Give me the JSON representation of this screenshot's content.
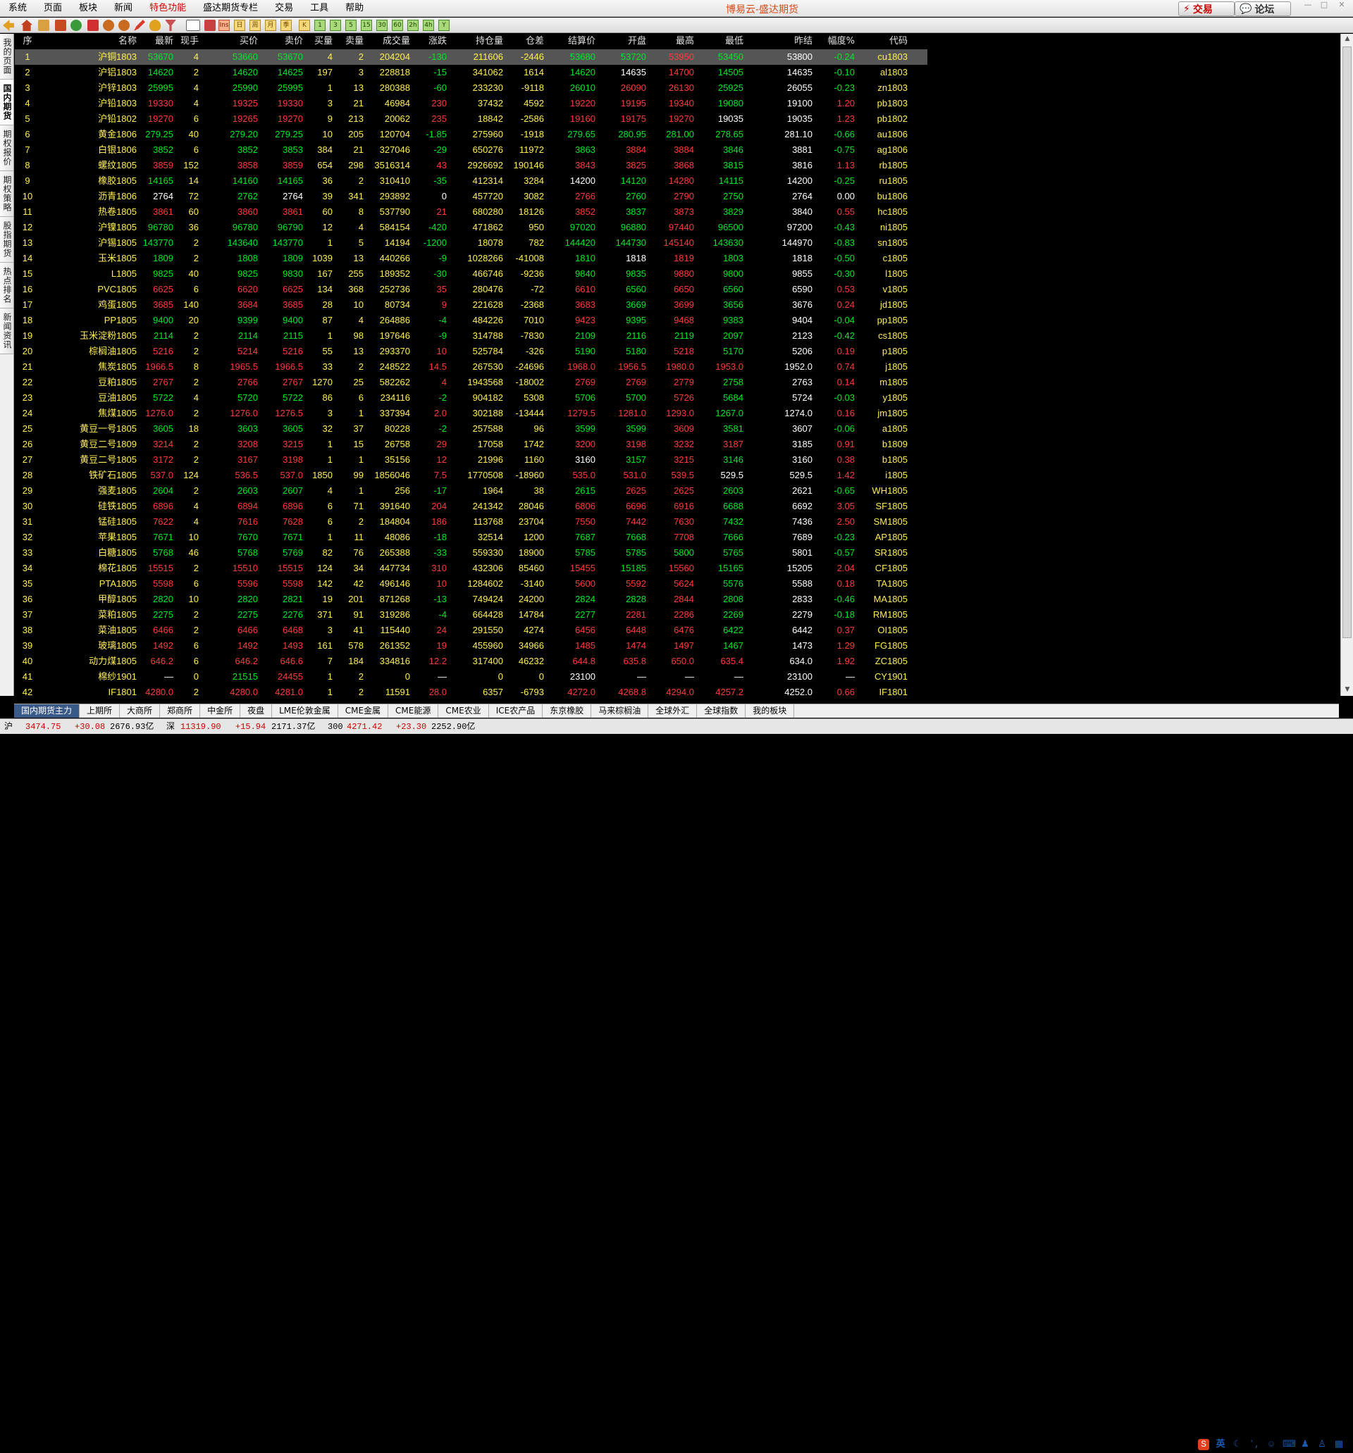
{
  "menu": [
    "系统",
    "页面",
    "板块",
    "新闻",
    "特色功能",
    "盛达期货专栏",
    "交易",
    "工具",
    "帮助"
  ],
  "app_title": "博易云-盛达期货",
  "buttons": {
    "trade": "交易",
    "forum": "论坛"
  },
  "toolbar_keys": [
    "Ins",
    "日",
    "周",
    "月",
    "季",
    "K",
    "1",
    "3",
    "5",
    "15",
    "30",
    "60",
    "2h",
    "4h",
    "Y"
  ],
  "left_nav": [
    "我的页面",
    "国内期货",
    "期权报价",
    "期权策略",
    "股指期货",
    "热点排名",
    "新闻资讯"
  ],
  "columns": [
    "序",
    "名称",
    "最新",
    "现手",
    "买价",
    "卖价",
    "买量",
    "卖量",
    "成交量",
    "涨跌",
    "持仓量",
    "仓差",
    "结算价",
    "开盘",
    "最高",
    "最低",
    "昨结",
    "幅度%",
    "代码"
  ],
  "rows": [
    [
      "1",
      "沪铜1803",
      "53670",
      "4",
      "53660",
      "53670",
      "4",
      "2",
      "204204",
      "-130",
      "211606",
      "-2446",
      "53680",
      "53720",
      "53950",
      "53450",
      "53800",
      "-0.24",
      "cu1803"
    ],
    [
      "2",
      "沪铝1803",
      "14620",
      "2",
      "14620",
      "14625",
      "197",
      "3",
      "228818",
      "-15",
      "341062",
      "1614",
      "14620",
      "14635",
      "14700",
      "14505",
      "14635",
      "-0.10",
      "al1803"
    ],
    [
      "3",
      "沪锌1803",
      "25995",
      "4",
      "25990",
      "25995",
      "1",
      "13",
      "280388",
      "-60",
      "233230",
      "-9118",
      "26010",
      "26090",
      "26130",
      "25925",
      "26055",
      "-0.23",
      "zn1803"
    ],
    [
      "4",
      "沪铅1803",
      "19330",
      "4",
      "19325",
      "19330",
      "3",
      "21",
      "46984",
      "230",
      "37432",
      "4592",
      "19220",
      "19195",
      "19340",
      "19080",
      "19100",
      "1.20",
      "pb1803"
    ],
    [
      "5",
      "沪铅1802",
      "19270",
      "6",
      "19265",
      "19270",
      "9",
      "213",
      "20062",
      "235",
      "18842",
      "-2586",
      "19160",
      "19175",
      "19270",
      "19035",
      "19035",
      "1.23",
      "pb1802"
    ],
    [
      "6",
      "黄金1806",
      "279.25",
      "40",
      "279.20",
      "279.25",
      "10",
      "205",
      "120704",
      "-1.85",
      "275960",
      "-1918",
      "279.65",
      "280.95",
      "281.00",
      "278.65",
      "281.10",
      "-0.66",
      "au1806"
    ],
    [
      "7",
      "白银1806",
      "3852",
      "6",
      "3852",
      "3853",
      "384",
      "21",
      "327046",
      "-29",
      "650276",
      "11972",
      "3863",
      "3884",
      "3884",
      "3846",
      "3881",
      "-0.75",
      "ag1806"
    ],
    [
      "8",
      "螺纹1805",
      "3859",
      "152",
      "3858",
      "3859",
      "654",
      "298",
      "3516314",
      "43",
      "2926692",
      "190146",
      "3843",
      "3825",
      "3868",
      "3815",
      "3816",
      "1.13",
      "rb1805"
    ],
    [
      "9",
      "橡胶1805",
      "14165",
      "14",
      "14160",
      "14165",
      "36",
      "2",
      "310410",
      "-35",
      "412314",
      "3284",
      "14200",
      "14120",
      "14280",
      "14115",
      "14200",
      "-0.25",
      "ru1805"
    ],
    [
      "10",
      "沥青1806",
      "2764",
      "72",
      "2762",
      "2764",
      "39",
      "341",
      "293892",
      "0",
      "457720",
      "3082",
      "2766",
      "2760",
      "2790",
      "2750",
      "2764",
      "0.00",
      "bu1806"
    ],
    [
      "11",
      "热卷1805",
      "3861",
      "60",
      "3860",
      "3861",
      "60",
      "8",
      "537790",
      "21",
      "680280",
      "18126",
      "3852",
      "3837",
      "3873",
      "3829",
      "3840",
      "0.55",
      "hc1805"
    ],
    [
      "12",
      "沪镍1805",
      "96780",
      "36",
      "96780",
      "96790",
      "12",
      "4",
      "584154",
      "-420",
      "471862",
      "950",
      "97020",
      "96880",
      "97440",
      "96500",
      "97200",
      "-0.43",
      "ni1805"
    ],
    [
      "13",
      "沪锡1805",
      "143770",
      "2",
      "143640",
      "143770",
      "1",
      "5",
      "14194",
      "-1200",
      "18078",
      "782",
      "144420",
      "144730",
      "145140",
      "143630",
      "144970",
      "-0.83",
      "sn1805"
    ],
    [
      "14",
      "玉米1805",
      "1809",
      "2",
      "1808",
      "1809",
      "1039",
      "13",
      "440266",
      "-9",
      "1028266",
      "-41008",
      "1810",
      "1818",
      "1819",
      "1803",
      "1818",
      "-0.50",
      "c1805"
    ],
    [
      "15",
      "L1805",
      "9825",
      "40",
      "9825",
      "9830",
      "167",
      "255",
      "189352",
      "-30",
      "466746",
      "-9236",
      "9840",
      "9835",
      "9880",
      "9800",
      "9855",
      "-0.30",
      "l1805"
    ],
    [
      "16",
      "PVC1805",
      "6625",
      "6",
      "6620",
      "6625",
      "134",
      "368",
      "252736",
      "35",
      "280476",
      "-72",
      "6610",
      "6560",
      "6650",
      "6560",
      "6590",
      "0.53",
      "v1805"
    ],
    [
      "17",
      "鸡蛋1805",
      "3685",
      "140",
      "3684",
      "3685",
      "28",
      "10",
      "80734",
      "9",
      "221628",
      "-2368",
      "3683",
      "3669",
      "3699",
      "3656",
      "3676",
      "0.24",
      "jd1805"
    ],
    [
      "18",
      "PP1805",
      "9400",
      "20",
      "9399",
      "9400",
      "87",
      "4",
      "264886",
      "-4",
      "484226",
      "7010",
      "9423",
      "9395",
      "9468",
      "9383",
      "9404",
      "-0.04",
      "pp1805"
    ],
    [
      "19",
      "玉米淀粉1805",
      "2114",
      "2",
      "2114",
      "2115",
      "1",
      "98",
      "197646",
      "-9",
      "314788",
      "-7830",
      "2109",
      "2116",
      "2119",
      "2097",
      "2123",
      "-0.42",
      "cs1805"
    ],
    [
      "20",
      "棕榈油1805",
      "5216",
      "2",
      "5214",
      "5216",
      "55",
      "13",
      "293370",
      "10",
      "525784",
      "-326",
      "5190",
      "5180",
      "5218",
      "5170",
      "5206",
      "0.19",
      "p1805"
    ],
    [
      "21",
      "焦炭1805",
      "1966.5",
      "8",
      "1965.5",
      "1966.5",
      "33",
      "2",
      "248522",
      "14.5",
      "267530",
      "-24696",
      "1968.0",
      "1956.5",
      "1980.0",
      "1953.0",
      "1952.0",
      "0.74",
      "j1805"
    ],
    [
      "22",
      "豆粕1805",
      "2767",
      "2",
      "2766",
      "2767",
      "1270",
      "25",
      "582262",
      "4",
      "1943568",
      "-18002",
      "2769",
      "2769",
      "2779",
      "2758",
      "2763",
      "0.14",
      "m1805"
    ],
    [
      "23",
      "豆油1805",
      "5722",
      "4",
      "5720",
      "5722",
      "86",
      "6",
      "234116",
      "-2",
      "904182",
      "5308",
      "5706",
      "5700",
      "5726",
      "5684",
      "5724",
      "-0.03",
      "y1805"
    ],
    [
      "24",
      "焦煤1805",
      "1276.0",
      "2",
      "1276.0",
      "1276.5",
      "3",
      "1",
      "337394",
      "2.0",
      "302188",
      "-13444",
      "1279.5",
      "1281.0",
      "1293.0",
      "1267.0",
      "1274.0",
      "0.16",
      "jm1805"
    ],
    [
      "25",
      "黄豆一号1805",
      "3605",
      "18",
      "3603",
      "3605",
      "32",
      "37",
      "80228",
      "-2",
      "257588",
      "96",
      "3599",
      "3599",
      "3609",
      "3581",
      "3607",
      "-0.06",
      "a1805"
    ],
    [
      "26",
      "黄豆二号1809",
      "3214",
      "2",
      "3208",
      "3215",
      "1",
      "15",
      "26758",
      "29",
      "17058",
      "1742",
      "3200",
      "3198",
      "3232",
      "3187",
      "3185",
      "0.91",
      "b1809"
    ],
    [
      "27",
      "黄豆二号1805",
      "3172",
      "2",
      "3167",
      "3198",
      "1",
      "1",
      "35156",
      "12",
      "21996",
      "1160",
      "3160",
      "3157",
      "3215",
      "3146",
      "3160",
      "0.38",
      "b1805"
    ],
    [
      "28",
      "铁矿石1805",
      "537.0",
      "124",
      "536.5",
      "537.0",
      "1850",
      "99",
      "1856046",
      "7.5",
      "1770508",
      "-18960",
      "535.0",
      "531.0",
      "539.5",
      "529.5",
      "529.5",
      "1.42",
      "i1805"
    ],
    [
      "29",
      "强麦1805",
      "2604",
      "2",
      "2603",
      "2607",
      "4",
      "1",
      "256",
      "-17",
      "1964",
      "38",
      "2615",
      "2625",
      "2625",
      "2603",
      "2621",
      "-0.65",
      "WH1805"
    ],
    [
      "30",
      "硅铁1805",
      "6896",
      "4",
      "6894",
      "6896",
      "6",
      "71",
      "391640",
      "204",
      "241342",
      "28046",
      "6806",
      "6696",
      "6916",
      "6688",
      "6692",
      "3.05",
      "SF1805"
    ],
    [
      "31",
      "锰硅1805",
      "7622",
      "4",
      "7616",
      "7628",
      "6",
      "2",
      "184804",
      "186",
      "113768",
      "23704",
      "7550",
      "7442",
      "7630",
      "7432",
      "7436",
      "2.50",
      "SM1805"
    ],
    [
      "32",
      "苹果1805",
      "7671",
      "10",
      "7670",
      "7671",
      "1",
      "11",
      "48086",
      "-18",
      "32514",
      "1200",
      "7687",
      "7668",
      "7708",
      "7666",
      "7689",
      "-0.23",
      "AP1805"
    ],
    [
      "33",
      "白糖1805",
      "5768",
      "46",
      "5768",
      "5769",
      "82",
      "76",
      "265388",
      "-33",
      "559330",
      "18900",
      "5785",
      "5785",
      "5800",
      "5765",
      "5801",
      "-0.57",
      "SR1805"
    ],
    [
      "34",
      "棉花1805",
      "15515",
      "2",
      "15510",
      "15515",
      "124",
      "34",
      "447734",
      "310",
      "432306",
      "85460",
      "15455",
      "15185",
      "15560",
      "15165",
      "15205",
      "2.04",
      "CF1805"
    ],
    [
      "35",
      "PTA1805",
      "5598",
      "6",
      "5596",
      "5598",
      "142",
      "42",
      "496146",
      "10",
      "1284602",
      "-3140",
      "5600",
      "5592",
      "5624",
      "5576",
      "5588",
      "0.18",
      "TA1805"
    ],
    [
      "36",
      "甲醇1805",
      "2820",
      "10",
      "2820",
      "2821",
      "19",
      "201",
      "871268",
      "-13",
      "749424",
      "24200",
      "2824",
      "2828",
      "2844",
      "2808",
      "2833",
      "-0.46",
      "MA1805"
    ],
    [
      "37",
      "菜粕1805",
      "2275",
      "2",
      "2275",
      "2276",
      "371",
      "91",
      "319286",
      "-4",
      "664428",
      "14784",
      "2277",
      "2281",
      "2286",
      "2269",
      "2279",
      "-0.18",
      "RM1805"
    ],
    [
      "38",
      "菜油1805",
      "6466",
      "2",
      "6466",
      "6468",
      "3",
      "41",
      "115440",
      "24",
      "291550",
      "4274",
      "6456",
      "6448",
      "6476",
      "6422",
      "6442",
      "0.37",
      "OI1805"
    ],
    [
      "39",
      "玻璃1805",
      "1492",
      "6",
      "1492",
      "1493",
      "161",
      "578",
      "261352",
      "19",
      "455960",
      "34966",
      "1485",
      "1474",
      "1497",
      "1467",
      "1473",
      "1.29",
      "FG1805"
    ],
    [
      "40",
      "动力煤1805",
      "646.2",
      "6",
      "646.2",
      "646.6",
      "7",
      "184",
      "334816",
      "12.2",
      "317400",
      "46232",
      "644.8",
      "635.8",
      "650.0",
      "635.4",
      "634.0",
      "1.92",
      "ZC1805"
    ],
    [
      "41",
      "棉纱1901",
      "—",
      "0",
      "21515",
      "24455",
      "1",
      "2",
      "0",
      "—",
      "0",
      "0",
      "23100",
      "—",
      "—",
      "—",
      "23100",
      "—",
      "CY1901"
    ],
    [
      "42",
      "IF1801",
      "4280.0",
      "2",
      "4280.0",
      "4281.0",
      "1",
      "2",
      "11591",
      "28.0",
      "6357",
      "-6793",
      "4272.0",
      "4268.8",
      "4294.0",
      "4257.2",
      "4252.0",
      "0.66",
      "IF1801"
    ]
  ],
  "bottom_tabs": [
    "国内期货主力",
    "上期所",
    "大商所",
    "郑商所",
    "中金所",
    "夜盘",
    "LME伦敦金属",
    "CME金属",
    "CME能源",
    "CME农业",
    "ICE农产品",
    "东京橡胶",
    "马来棕榈油",
    "全球外汇",
    "全球指数",
    "我的板块"
  ],
  "status": {
    "sh_label": "沪",
    "sh_price": "3474.75",
    "sh_change": "+30.08",
    "sh_amount": "2676.93亿",
    "sz_label": "深",
    "sz_price": "11319.90",
    "sz_change": "+15.94",
    "sz_amount": "2171.37亿",
    "i300_label": "300",
    "i300_price": "4271.42",
    "i300_change": "+23.30",
    "i300_amount": "2252.90亿"
  },
  "tray": {
    "ime": "英"
  },
  "colors": {
    "up": "#ff3a3a",
    "down": "#00e828",
    "flat": "#ffffff",
    "highlight": "#ffee55"
  }
}
